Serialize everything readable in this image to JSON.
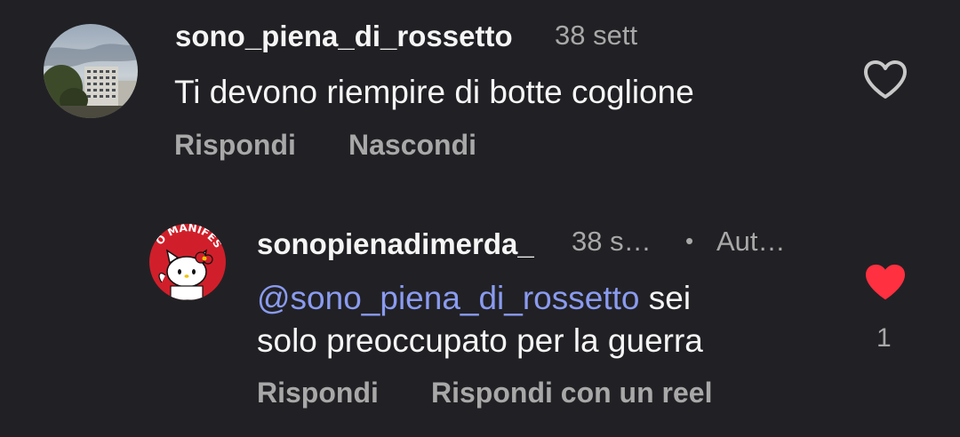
{
  "comments": [
    {
      "username": "sono_piena_di_rossetto",
      "time": "38 sett",
      "text": "Ti devono riempire di botte coglione",
      "liked": false,
      "actions": [
        "Rispondi",
        "Nascondi"
      ]
    },
    {
      "username": "sonopienadimerda_",
      "time": "38 s…",
      "separator": "•",
      "author_badge": "Aut…",
      "mention": "@sono_piena_di_rossetto",
      "text_after_mention": " sei",
      "text_line2": "solo preoccupato per la guerra",
      "liked": true,
      "like_count": "1",
      "actions": [
        "Rispondi",
        "Rispondi con un reel"
      ],
      "avatar_text": "O MANIFESTO"
    }
  ],
  "colors": {
    "background": "#212125",
    "text_primary": "#f5f5f5",
    "text_secondary": "#a8a8a8",
    "mention": "#8a9bf0",
    "heart_liked": "#ff3040",
    "heart_outline": "#c8c8c8"
  },
  "icons": {
    "like_outline": "heart-outline-icon",
    "like_filled": "heart-filled-icon",
    "threads_mention": "threads-at-icon"
  }
}
